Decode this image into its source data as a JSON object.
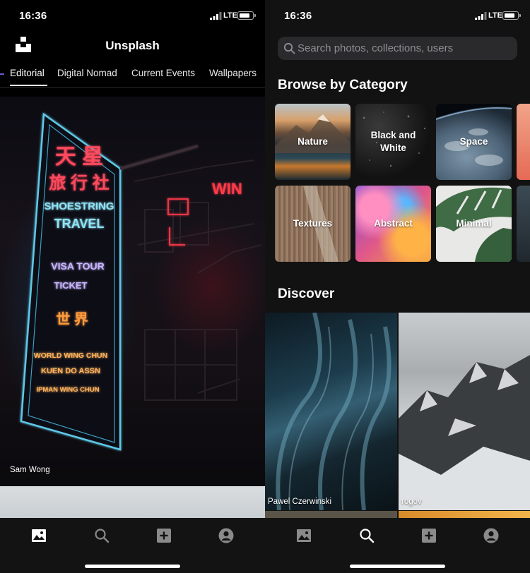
{
  "left": {
    "status": {
      "time": "16:36",
      "network": "LTE"
    },
    "header": {
      "title": "Unsplash"
    },
    "tabs": [
      {
        "label": "Editorial",
        "active": true
      },
      {
        "label": "Digital Nomad",
        "active": false
      },
      {
        "label": "Current Events",
        "active": false
      },
      {
        "label": "Wallpapers",
        "active": false
      }
    ],
    "feed": {
      "photo_credit": "Sam Wong",
      "sign_lines": [
        "天 星",
        "旅 行 社",
        "SHOESTRING",
        "TRAVEL",
        "VISA TOUR",
        "TICKET",
        "世 界",
        "WORLD WING CHUN",
        "KUEN DO ASSN",
        "IPMAN WING CHUN"
      ],
      "red_sign": "WIN"
    },
    "tabbar": [
      "photos-icon",
      "search-icon",
      "add-icon",
      "profile-icon"
    ],
    "active_tab": "photos"
  },
  "right": {
    "status": {
      "time": "16:36",
      "network": "LTE"
    },
    "search": {
      "placeholder": "Search photos, collections, users"
    },
    "browse": {
      "title": "Browse by Category",
      "categories": [
        {
          "label": "Nature"
        },
        {
          "label": "Black and White"
        },
        {
          "label": "Space"
        },
        {
          "label": "Textures"
        },
        {
          "label": "Abstract"
        },
        {
          "label": "Minimal"
        }
      ]
    },
    "discover": {
      "title": "Discover",
      "photos": [
        {
          "credit": "Pawel Czerwinski"
        },
        {
          "credit": "rogov"
        }
      ]
    },
    "tabbar": [
      "photos-icon",
      "search-icon",
      "add-icon",
      "profile-icon"
    ],
    "active_tab": "search"
  },
  "colors": {
    "background": "#000000",
    "panel_dark": "#121212",
    "tabbar": "#131313",
    "search_bg": "#2a2a2c",
    "placeholder": "#8e8e93",
    "neon_blue": "#5ec8e6",
    "neon_red": "#ff3b4a",
    "neon_orange": "#ff9a3c"
  }
}
